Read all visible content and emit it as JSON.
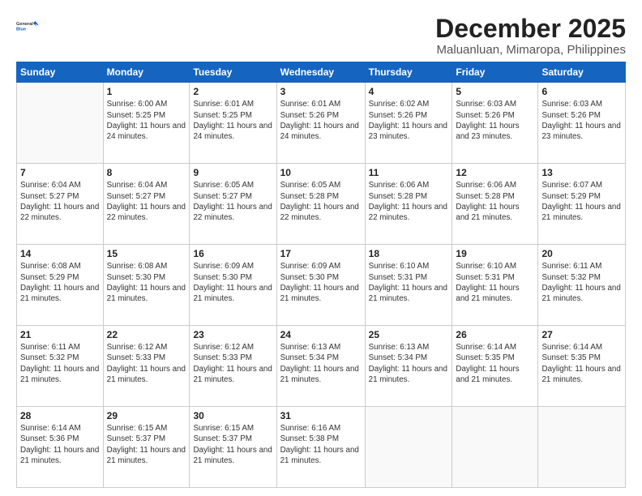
{
  "header": {
    "logo_general": "General",
    "logo_blue": "Blue",
    "title": "December 2025",
    "subtitle": "Maluanluan, Mimaropa, Philippines"
  },
  "calendar": {
    "days_of_week": [
      "Sunday",
      "Monday",
      "Tuesday",
      "Wednesday",
      "Thursday",
      "Friday",
      "Saturday"
    ],
    "weeks": [
      [
        {
          "num": "",
          "info": ""
        },
        {
          "num": "1",
          "info": "Sunrise: 6:00 AM\nSunset: 5:25 PM\nDaylight: 11 hours\nand 24 minutes."
        },
        {
          "num": "2",
          "info": "Sunrise: 6:01 AM\nSunset: 5:25 PM\nDaylight: 11 hours\nand 24 minutes."
        },
        {
          "num": "3",
          "info": "Sunrise: 6:01 AM\nSunset: 5:26 PM\nDaylight: 11 hours\nand 24 minutes."
        },
        {
          "num": "4",
          "info": "Sunrise: 6:02 AM\nSunset: 5:26 PM\nDaylight: 11 hours\nand 23 minutes."
        },
        {
          "num": "5",
          "info": "Sunrise: 6:03 AM\nSunset: 5:26 PM\nDaylight: 11 hours\nand 23 minutes."
        },
        {
          "num": "6",
          "info": "Sunrise: 6:03 AM\nSunset: 5:26 PM\nDaylight: 11 hours\nand 23 minutes."
        }
      ],
      [
        {
          "num": "7",
          "info": "Sunrise: 6:04 AM\nSunset: 5:27 PM\nDaylight: 11 hours\nand 22 minutes."
        },
        {
          "num": "8",
          "info": "Sunrise: 6:04 AM\nSunset: 5:27 PM\nDaylight: 11 hours\nand 22 minutes."
        },
        {
          "num": "9",
          "info": "Sunrise: 6:05 AM\nSunset: 5:27 PM\nDaylight: 11 hours\nand 22 minutes."
        },
        {
          "num": "10",
          "info": "Sunrise: 6:05 AM\nSunset: 5:28 PM\nDaylight: 11 hours\nand 22 minutes."
        },
        {
          "num": "11",
          "info": "Sunrise: 6:06 AM\nSunset: 5:28 PM\nDaylight: 11 hours\nand 22 minutes."
        },
        {
          "num": "12",
          "info": "Sunrise: 6:06 AM\nSunset: 5:28 PM\nDaylight: 11 hours\nand 21 minutes."
        },
        {
          "num": "13",
          "info": "Sunrise: 6:07 AM\nSunset: 5:29 PM\nDaylight: 11 hours\nand 21 minutes."
        }
      ],
      [
        {
          "num": "14",
          "info": "Sunrise: 6:08 AM\nSunset: 5:29 PM\nDaylight: 11 hours\nand 21 minutes."
        },
        {
          "num": "15",
          "info": "Sunrise: 6:08 AM\nSunset: 5:30 PM\nDaylight: 11 hours\nand 21 minutes."
        },
        {
          "num": "16",
          "info": "Sunrise: 6:09 AM\nSunset: 5:30 PM\nDaylight: 11 hours\nand 21 minutes."
        },
        {
          "num": "17",
          "info": "Sunrise: 6:09 AM\nSunset: 5:30 PM\nDaylight: 11 hours\nand 21 minutes."
        },
        {
          "num": "18",
          "info": "Sunrise: 6:10 AM\nSunset: 5:31 PM\nDaylight: 11 hours\nand 21 minutes."
        },
        {
          "num": "19",
          "info": "Sunrise: 6:10 AM\nSunset: 5:31 PM\nDaylight: 11 hours\nand 21 minutes."
        },
        {
          "num": "20",
          "info": "Sunrise: 6:11 AM\nSunset: 5:32 PM\nDaylight: 11 hours\nand 21 minutes."
        }
      ],
      [
        {
          "num": "21",
          "info": "Sunrise: 6:11 AM\nSunset: 5:32 PM\nDaylight: 11 hours\nand 21 minutes."
        },
        {
          "num": "22",
          "info": "Sunrise: 6:12 AM\nSunset: 5:33 PM\nDaylight: 11 hours\nand 21 minutes."
        },
        {
          "num": "23",
          "info": "Sunrise: 6:12 AM\nSunset: 5:33 PM\nDaylight: 11 hours\nand 21 minutes."
        },
        {
          "num": "24",
          "info": "Sunrise: 6:13 AM\nSunset: 5:34 PM\nDaylight: 11 hours\nand 21 minutes."
        },
        {
          "num": "25",
          "info": "Sunrise: 6:13 AM\nSunset: 5:34 PM\nDaylight: 11 hours\nand 21 minutes."
        },
        {
          "num": "26",
          "info": "Sunrise: 6:14 AM\nSunset: 5:35 PM\nDaylight: 11 hours\nand 21 minutes."
        },
        {
          "num": "27",
          "info": "Sunrise: 6:14 AM\nSunset: 5:35 PM\nDaylight: 11 hours\nand 21 minutes."
        }
      ],
      [
        {
          "num": "28",
          "info": "Sunrise: 6:14 AM\nSunset: 5:36 PM\nDaylight: 11 hours\nand 21 minutes."
        },
        {
          "num": "29",
          "info": "Sunrise: 6:15 AM\nSunset: 5:37 PM\nDaylight: 11 hours\nand 21 minutes."
        },
        {
          "num": "30",
          "info": "Sunrise: 6:15 AM\nSunset: 5:37 PM\nDaylight: 11 hours\nand 21 minutes."
        },
        {
          "num": "31",
          "info": "Sunrise: 6:16 AM\nSunset: 5:38 PM\nDaylight: 11 hours\nand 21 minutes."
        },
        {
          "num": "",
          "info": ""
        },
        {
          "num": "",
          "info": ""
        },
        {
          "num": "",
          "info": ""
        }
      ]
    ]
  }
}
